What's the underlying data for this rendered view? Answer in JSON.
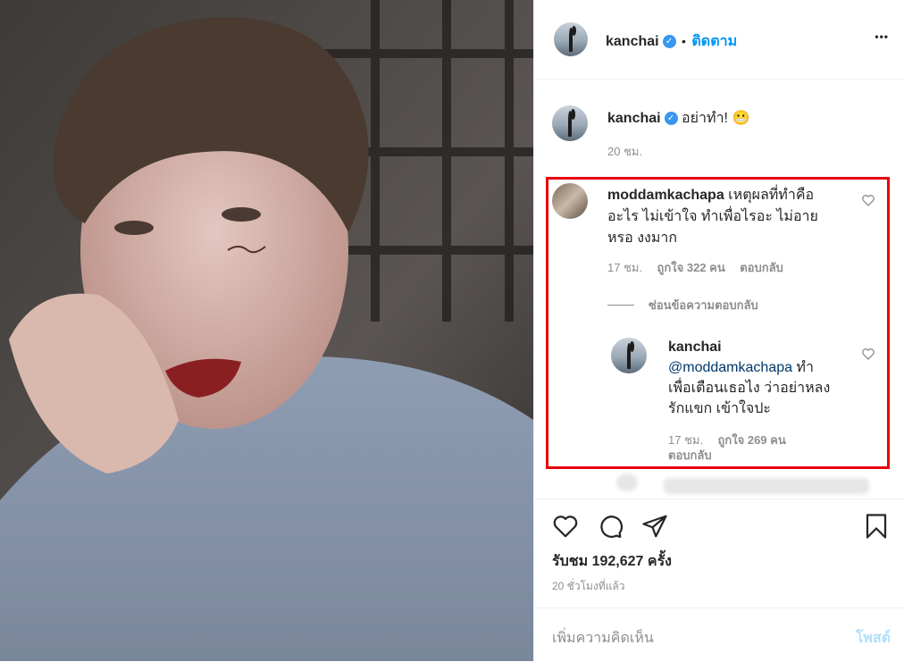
{
  "header": {
    "username": "kanchai",
    "separator": "•",
    "follow_label": "ติดตาม",
    "more_label": "•••"
  },
  "caption": {
    "username": "kanchai",
    "text": "อย่าทำ! 😬",
    "time": "20 ชม."
  },
  "comments": [
    {
      "username": "moddamkachapa",
      "text_line1": "เหตุผลที่ทำคือ",
      "text_line2": "อะไร ไม่เข้าใจ ทำเพื่อไรอะ ไม่อาย",
      "text_line3": "หรอ งงมาก",
      "time": "17 ชม.",
      "likes": "ถูกใจ 322 คน",
      "reply_label": "ตอบกลับ",
      "hide_replies": "ซ่อนข้อความตอบกลับ",
      "replies": [
        {
          "username": "kanchai",
          "mention": "@moddamkachapa",
          "text_line1": " ทำ",
          "text_line2": "เพื่อเตือนเธอไง ว่าอย่าหลง",
          "text_line3": "รักแขก เข้าใจปะ",
          "time": "17 ชม.",
          "likes": "ถูกใจ 269 คน",
          "reply_label": "ตอบกลับ"
        }
      ]
    }
  ],
  "stats": {
    "views": "รับชม 192,627 ครั้ง",
    "posted_ago": "20 ชั่วโมงที่แล้ว"
  },
  "comment_box": {
    "placeholder": "เพิ่มความคิดเห็น",
    "post_label": "โพสต์"
  },
  "colors": {
    "accent_blue": "#0095f6",
    "highlight_red": "#e8000b",
    "verified_blue": "#3897f0"
  },
  "icons": [
    "heart-icon",
    "comment-icon",
    "share-icon",
    "bookmark-icon",
    "verified-icon",
    "more-icon"
  ]
}
